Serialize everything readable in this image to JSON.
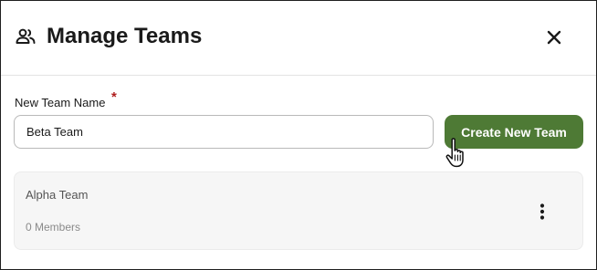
{
  "dialog": {
    "title": "Manage Teams",
    "header_icon": "people-icon",
    "close_icon": "close-icon"
  },
  "form": {
    "label": "New Team Name",
    "required_mark": "*",
    "input_value": "Beta Team",
    "create_button_label": "Create New Team"
  },
  "teams": [
    {
      "name": "Alpha Team",
      "members": "0 Members",
      "menu_icon": "more-vertical-icon"
    }
  ],
  "colors": {
    "accent": "#4e7a35",
    "required": "#b01e1e"
  },
  "cursor_icon": "hand-pointer-icon"
}
